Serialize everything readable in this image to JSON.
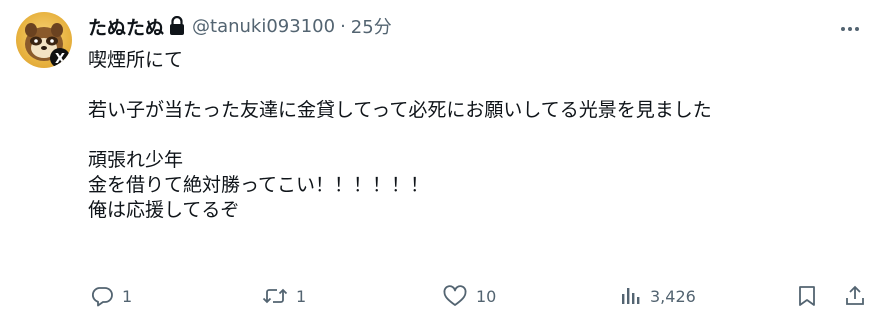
{
  "tweet": {
    "display_name": "たぬたぬ",
    "handle": "@tanuki093100",
    "separator": "·",
    "time": "25分",
    "lines": [
      "喫煙所にて",
      "",
      "若い子が当たった友達に金貸してって必死にお願いしてる光景を見ました",
      "",
      "頑張れ少年",
      "金を借りて絶対勝ってこい！！！！！！",
      "俺は応援してるぞ"
    ]
  },
  "actions": {
    "reply_count": "1",
    "retweet_count": "1",
    "like_count": "10",
    "views_count": "3,426"
  },
  "icons": [
    "lock-icon",
    "more-icon",
    "reply-icon",
    "retweet-icon",
    "like-icon",
    "views-icon",
    "bookmark-icon",
    "share-icon"
  ],
  "colors": {
    "text": "#0f1419",
    "secondary": "#536471"
  }
}
